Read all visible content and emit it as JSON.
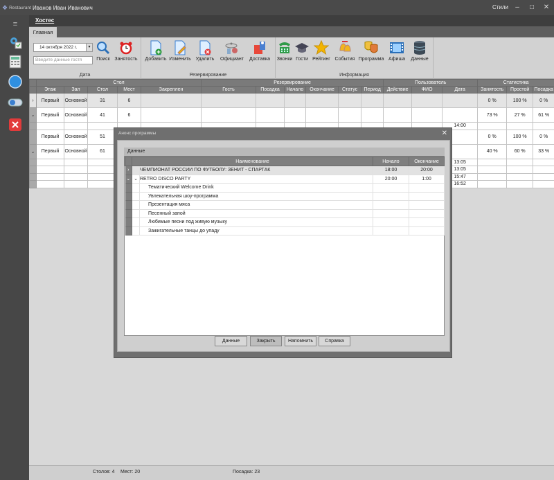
{
  "app": {
    "name": "Restaurant",
    "user": "Иванов Иван Иванович",
    "styles_label": "Стили"
  },
  "tab": {
    "title": "Хостес",
    "ribbon_tab": "Главная"
  },
  "ribbon": {
    "date_value": "14 октября 2022 г.",
    "search_placeholder": "Введите данные гостя",
    "groups": {
      "date": "Дата",
      "reservation": "Резервирование",
      "info": "Информация"
    },
    "buttons": {
      "search": "Поиск",
      "occupancy": "Занятость",
      "add": "Добавить",
      "edit": "Изменить",
      "delete": "Удалить",
      "waiter": "Официант",
      "delivery": "Доставка",
      "calls": "Звонки",
      "guests": "Гости",
      "rating": "Рейтинг",
      "events": "События",
      "program": "Программа",
      "poster": "Афиша",
      "data": "Данные"
    }
  },
  "grid": {
    "bands": {
      "table": "Стол",
      "reservation": "Резервирование",
      "user": "Пользователь",
      "stats": "Статистика"
    },
    "columns": [
      "Этаж",
      "Зал",
      "Стол",
      "Мест",
      "Закреплен",
      "Гость",
      "Посадка",
      "Начало",
      "Окончание",
      "Статус",
      "Период",
      "Действие",
      "ФИО",
      "Дата",
      "Занятость",
      "Простой",
      "Посадка"
    ],
    "rows": [
      {
        "floor": "Первый",
        "hall": "Основной",
        "table": "31",
        "seats": "6",
        "busy": "0 %",
        "idle": "100 %",
        "seated": "0 %"
      },
      {
        "floor": "Первый",
        "hall": "Основной",
        "table": "41",
        "seats": "6",
        "busy": "73 %",
        "idle": "27 %",
        "seated": "61 %"
      },
      {
        "date": "14:00"
      },
      {
        "floor": "Первый",
        "hall": "Основной",
        "table": "51",
        "busy": "0 %",
        "idle": "100 %",
        "seated": "0 %"
      },
      {
        "floor": "Первый",
        "hall": "Основной",
        "table": "61",
        "busy": "40 %",
        "idle": "60 %",
        "seated": "33 %"
      },
      {
        "date": "13:05"
      },
      {
        "date": "13:05"
      },
      {
        "date": "15:47"
      },
      {
        "date": "16:52"
      }
    ]
  },
  "status": {
    "tables": "Столов: 4",
    "places": "Мест: 20",
    "seated": "Посадка: 23"
  },
  "modal": {
    "title": "Анонс программы",
    "panel": "Данные",
    "columns": {
      "name": "Наименование",
      "start": "Начало",
      "end": "Окончание"
    },
    "rows": [
      {
        "name": "ЧЕМПИОНАТ РОССИИ ПО ФУТБОЛУ: ЗЕНИТ - СПАРТАК",
        "start": "18:00",
        "end": "20:00"
      },
      {
        "name": "RETRO DISCO PARTY",
        "start": "20:00",
        "end": "1:00"
      },
      {
        "name": "Тематический Welcome Drink"
      },
      {
        "name": "Увлекательная шоу-программа"
      },
      {
        "name": "Презентация мяса"
      },
      {
        "name": "Песенный запой"
      },
      {
        "name": "Любимые песни под живую музыку"
      },
      {
        "name": "Зажигательные танцы до упаду"
      }
    ],
    "buttons": {
      "data": "Данные",
      "close": "Закрыть",
      "remind": "Напомнить",
      "help": "Справка"
    }
  },
  "colors": {
    "accent_blue": "#2f8fe0",
    "danger": "#e23b3b"
  }
}
